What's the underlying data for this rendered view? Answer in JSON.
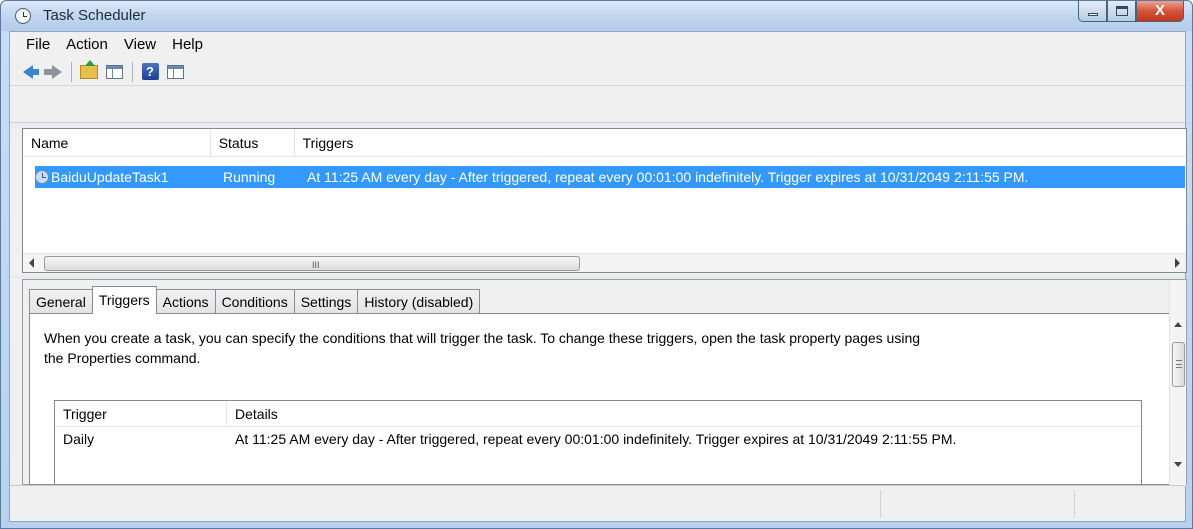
{
  "window": {
    "title": "Task Scheduler"
  },
  "menu": [
    "File",
    "Action",
    "View",
    "Help"
  ],
  "toolbar": {
    "buttons": [
      "back-icon",
      "forward-icon",
      "folder-up-icon",
      "show-hide-pane-icon",
      "help-icon",
      "action-pane-icon"
    ]
  },
  "tasklist": {
    "columns": [
      "Name",
      "Status",
      "Triggers"
    ],
    "rows": [
      {
        "name": "BaiduUpdateTask1",
        "status": "Running",
        "triggers": "At 11:25 AM every day - After triggered, repeat every 00:01:00 indefinitely. Trigger expires at 10/31/2049 2:11:55 PM."
      }
    ],
    "scroll_grip": "III"
  },
  "tabs": [
    "General",
    "Triggers",
    "Actions",
    "Conditions",
    "Settings",
    "History (disabled)"
  ],
  "triggers_tab": {
    "description_line1": "When you create a task, you can specify the conditions that will trigger the task.  To change these triggers, open the task property pages using",
    "description_line2": "the Properties command.",
    "columns": [
      "Trigger",
      "Details"
    ],
    "rows": [
      {
        "trigger": "Daily",
        "details": "At 11:25 AM every day - After triggered, repeat every 00:01:00 indefinitely. Trigger expires at 10/31/2049 2:11:55 PM."
      }
    ]
  },
  "caption": {
    "close_glyph": "X"
  }
}
